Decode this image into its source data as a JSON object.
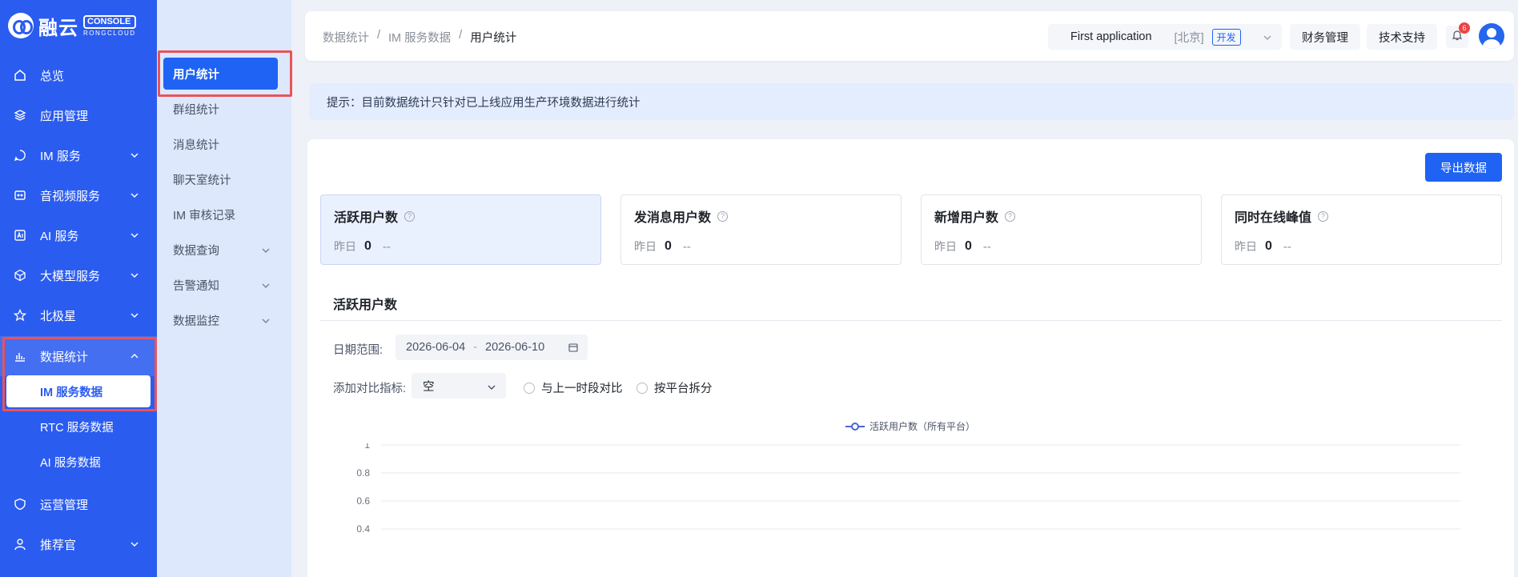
{
  "brand": {
    "name": "融云",
    "console": "CONSOLE",
    "sub": "RONGCLOUD"
  },
  "sidebar": {
    "items": [
      {
        "label": "总览",
        "icon": "home-icon"
      },
      {
        "label": "应用管理",
        "icon": "layers-icon"
      },
      {
        "label": "IM 服务",
        "icon": "chat-icon"
      },
      {
        "label": "音视频服务",
        "icon": "video-icon"
      },
      {
        "label": "AI 服务",
        "icon": "ai-icon"
      },
      {
        "label": "大模型服务",
        "icon": "cube-icon"
      },
      {
        "label": "北极星",
        "icon": "star-icon"
      },
      {
        "label": "数据统计",
        "icon": "bar-chart-icon"
      },
      {
        "label": "运营管理",
        "icon": "shield-icon"
      },
      {
        "label": "推荐官",
        "icon": "user-icon"
      }
    ],
    "sub_items": [
      "IM 服务数据",
      "RTC 服务数据",
      "AI 服务数据"
    ]
  },
  "submenu": {
    "items": [
      "用户统计",
      "群组统计",
      "消息统计",
      "聊天室统计",
      "IM 审核记录",
      "数据查询",
      "告警通知",
      "数据监控"
    ]
  },
  "header": {
    "breadcrumb": [
      "数据统计",
      "/",
      "IM 服务数据",
      "/",
      "用户统计"
    ],
    "app_name": "First application",
    "region": "[北京]",
    "env": "开发",
    "finance": "财务管理",
    "support": "技术支持",
    "notifications": "6"
  },
  "notice": "提示：目前数据统计只针对已上线应用生产环境数据进行统计",
  "main": {
    "export_label": "导出数据",
    "metrics": [
      {
        "title": "活跃用户数",
        "label": "昨日",
        "value": "0",
        "delta": "--"
      },
      {
        "title": "发消息用户数",
        "label": "昨日",
        "value": "0",
        "delta": "--"
      },
      {
        "title": "新增用户数",
        "label": "昨日",
        "value": "0",
        "delta": "--"
      },
      {
        "title": "同时在线峰值",
        "label": "昨日",
        "value": "0",
        "delta": "--"
      }
    ],
    "section_title": "活跃用户数",
    "date_label": "日期范围:",
    "date_start": "2026-06-04",
    "date_sep": "-",
    "date_end": "2026-06-10",
    "compare_label": "添加对比指标:",
    "compare_value": "空",
    "radio_prev": "与上一时段对比",
    "radio_platform": "按平台拆分"
  },
  "chart_data": {
    "type": "line",
    "series": [
      {
        "name": "活跃用户数（所有平台）",
        "values": []
      }
    ],
    "y_ticks": [
      "1",
      "0.8",
      "0.6",
      "0.4"
    ],
    "ylim": [
      0,
      1
    ],
    "color": "#4a66d6"
  }
}
